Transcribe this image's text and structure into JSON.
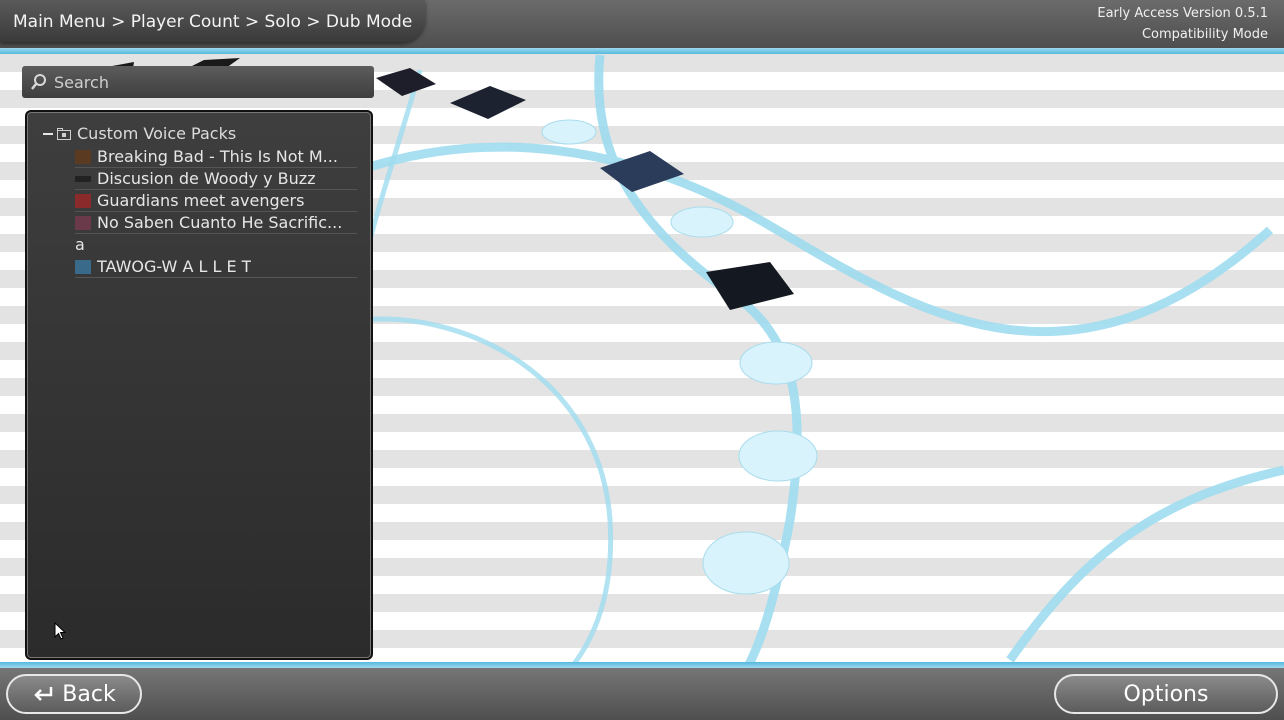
{
  "header": {
    "breadcrumb": "Main Menu > Player Count > Solo > Dub Mode",
    "version_line1": "Early Access Version 0.5.1",
    "version_line2": "Compatibility Mode"
  },
  "search": {
    "placeholder": "Search"
  },
  "tree": {
    "root_label": "Custom Voice Packs",
    "items": [
      {
        "label": "Breaking Bad - This Is Not M...",
        "thumb": "#5a3a20"
      },
      {
        "label": "Discusion de Woody y Buzz",
        "thumb": "#222222"
      },
      {
        "label": "Guardians meet avengers",
        "thumb": "#8a2a2a"
      },
      {
        "label": "No Saben Cuanto He Sacrific...",
        "thumb": "#6b3a4a"
      },
      {
        "label": "a",
        "thumb": ""
      },
      {
        "label": "TAWOG-W A L L E T",
        "thumb": "#3a6a8a"
      }
    ]
  },
  "footer": {
    "back_label": "Back",
    "options_label": "Options"
  },
  "colors": {
    "accent": "#55b9de",
    "path_node": "#d8f3fb",
    "panel": "#333333"
  }
}
